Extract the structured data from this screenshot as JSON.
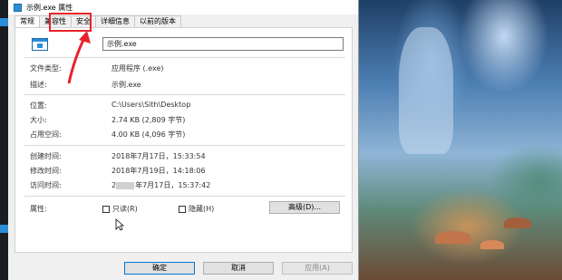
{
  "window": {
    "title": "示例.exe 属性"
  },
  "tabs": [
    {
      "label": "常规"
    },
    {
      "label": "兼容性"
    },
    {
      "label": "安全"
    },
    {
      "label": "详细信息"
    },
    {
      "label": "以前的版本"
    }
  ],
  "file": {
    "name": "示例.exe"
  },
  "props": {
    "type_label": "文件类型:",
    "type_value": "应用程序 (.exe)",
    "desc_label": "描述:",
    "desc_value": "示例.exe",
    "location_label": "位置:",
    "location_value": "C:\\Users\\Sith\\Desktop",
    "size_label": "大小:",
    "size_value": "2.74 KB (2,809 字节)",
    "disk_label": "占用空间:",
    "disk_value": "4.00 KB (4,096 字节)",
    "created_label": "创建时间:",
    "created_value": "2018年7月17日，15:33:54",
    "modified_label": "修改时间:",
    "modified_value": "2018年7月19日，14:18:06",
    "accessed_label": "访问时间:",
    "accessed_value_prefix": "2",
    "accessed_value": "年7月17日，15:37:42",
    "attr_label": "属性:",
    "readonly_label": "只读(R)",
    "hidden_label": "隐藏(H)",
    "advanced_label": "高级(D)..."
  },
  "buttons": {
    "ok": "确定",
    "cancel": "取消",
    "apply": "应用(A)"
  },
  "colors": {
    "highlight": "#e8212a",
    "accent": "#2a8fd8"
  }
}
